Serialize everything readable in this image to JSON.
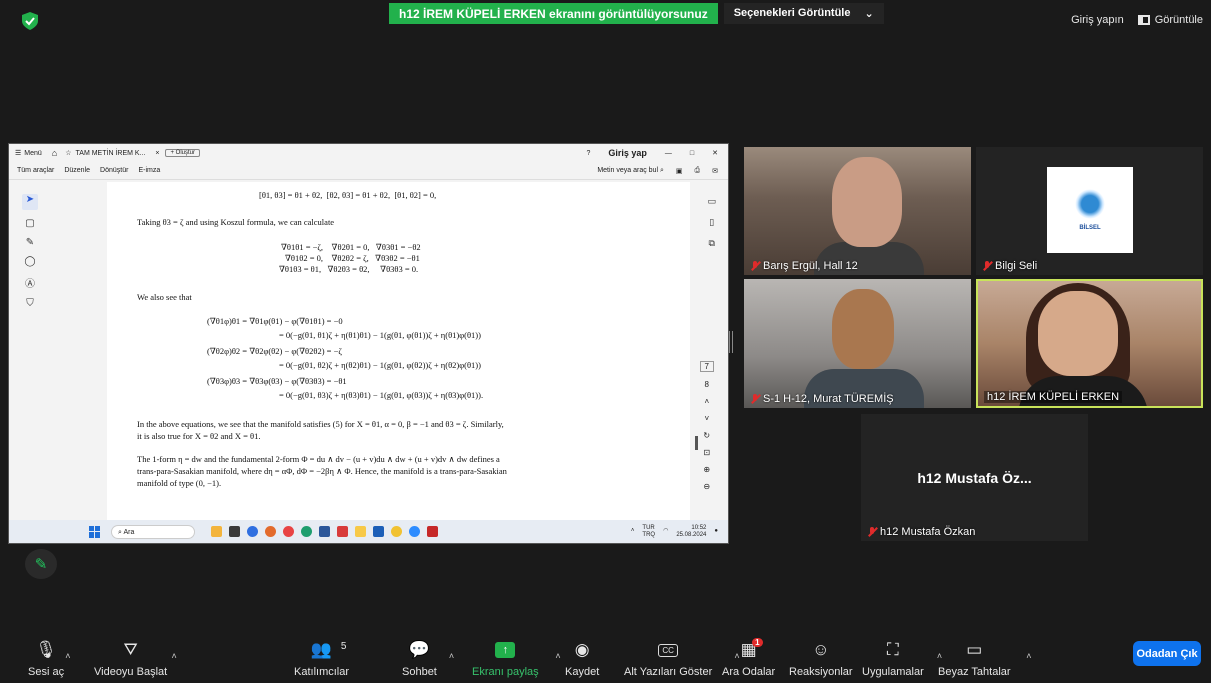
{
  "top": {
    "share_text": "h12 İREM KÜPELİ ERKEN ekranını görüntülüyorsunuz",
    "view_options": "Seçenekleri Görüntüle",
    "signin": "Giriş yapın",
    "view": "Görüntüle"
  },
  "pdf": {
    "menu": "Menü",
    "tab_title": "TAM METİN İREM K...",
    "tab_close": "×",
    "create": "Oluştur",
    "signin": "Giriş yap",
    "toolbar": [
      "Tüm araçlar",
      "Düzenle",
      "Dönüştür",
      "E-imza"
    ],
    "find": "Metin veya araç bul",
    "page_numbers": [
      "7",
      "8"
    ],
    "lines": [
      "[θ1, θ3] = θ1 + θ2,  [θ2, θ3] = θ1 + θ2,  [θ1, θ2] = 0,",
      "Taking θ3 = ζ and using Koszul formula, we can calculate",
      "∇θ1θ1 = −ζ,    ∇θ2θ1 = 0,   ∇θ3θ1 = −θ2",
      "∇θ1θ2 = 0,    ∇θ2θ2 = ζ,   ∇θ3θ2 = −θ1",
      "∇θ1θ3 = θ1,   ∇θ2θ3 = θ2,     ∇θ3θ3 = 0.",
      "We also see that",
      "(∇θ1φ)θ1 = ∇θ1φ(θ1) − φ(∇θ1θ1) = −0",
      "= 0(−g(θ1, θ1)ζ + η(θ1)θ1) − 1(g(θ1, φ(θ1))ζ + η(θ1)φ(θ1))",
      "(∇θ2φ)θ2 = ∇θ2φ(θ2) − φ(∇θ2θ2) = −ζ",
      "= 0(−g(θ1, θ2)ζ + η(θ2)θ1) − 1(g(θ1, φ(θ2))ζ + η(θ2)φ(θ1))",
      "(∇θ3φ)θ3 = ∇θ3φ(θ3) − φ(∇θ3θ3) = −θ1",
      "= 0(−g(θ1, θ3)ζ + η(θ3)θ1) − 1(g(θ1, φ(θ3))ζ + η(θ3)φ(θ1)).",
      "In the above equations, we see that the manifold satisfies (5) for X = θ1, α = 0, β = −1 and θ3 = ζ. Similarly,",
      "it is also true for X = θ2 and X = θ1.",
      "The 1-form η = dw and the fundamental 2-form Φ = du ∧ dv − (u + v)du ∧ dw + (u + v)dv ∧ dw defines a",
      "trans-para-Sasakian manifold, where dη = αΦ, dΦ = −2βη ∧ Φ. Hence, the manifold is a trans-para-Sasakian",
      "manifold of type (0, −1)."
    ],
    "taskbar": {
      "search": "Ara",
      "lang1": "TUR",
      "lang2": "TRQ",
      "time": "10:52",
      "date": "25.08.2024"
    }
  },
  "tiles": [
    {
      "name": "Barış Ergül, Hall 12"
    },
    {
      "name": "Bilgi Seli",
      "logo_text": "BİLSEL"
    },
    {
      "name": "S-1 H-12, Murat TÜREMİŞ"
    },
    {
      "name": "h12 İREM KÜPELİ ERKEN"
    },
    {
      "name": "h12 Mustafa Özkan",
      "big": "h12 Mustafa Öz..."
    }
  ],
  "controls": {
    "audio": "Sesi aç",
    "video": "Videoyu Başlat",
    "participants": "Katılımcılar",
    "participants_count": "5",
    "chat": "Sohbet",
    "share": "Ekranı paylaş",
    "record": "Kaydet",
    "captions": "Alt Yazıları Göster",
    "breakout": "Ara Odalar",
    "breakout_badge": "1",
    "reactions": "Reaksiyonlar",
    "apps": "Uygulamalar",
    "whiteboard": "Beyaz Tahtalar",
    "leave": "Odadan Çık"
  },
  "colors": {
    "share_green": "#22b14c",
    "leave_blue": "#0e72ed",
    "active_speaker": "#c8e35a",
    "muted_red": "#e02b2b"
  }
}
